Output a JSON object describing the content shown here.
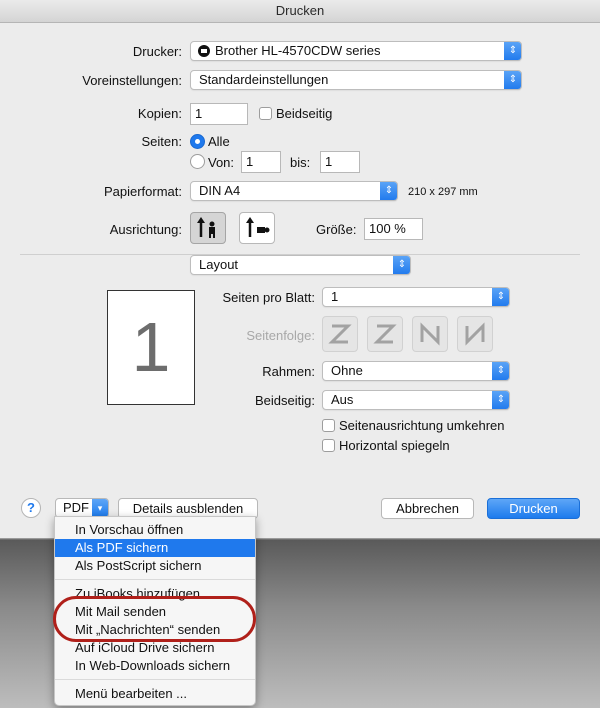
{
  "window": {
    "title": "Drucken"
  },
  "printer": {
    "label": "Drucker:",
    "value": "Brother HL-4570CDW series"
  },
  "presets": {
    "label": "Voreinstellungen:",
    "value": "Standardeinstellungen"
  },
  "copies": {
    "label": "Kopien:",
    "value": "1",
    "duplex_label": "Beidseitig"
  },
  "pages": {
    "label": "Seiten:",
    "all_label": "Alle",
    "from_label": "Von:",
    "from_value": "1",
    "to_label": "bis:",
    "to_value": "1"
  },
  "paper": {
    "label": "Papierformat:",
    "value": "DIN A4",
    "dimensions": "210 x 297 mm"
  },
  "orientation": {
    "label": "Ausrichtung:",
    "scale_label": "Größe:",
    "scale_value": "100 %"
  },
  "section": {
    "value": "Layout"
  },
  "layout": {
    "preview_number": "1",
    "pages_per_sheet_label": "Seiten pro Blatt:",
    "pages_per_sheet_value": "1",
    "order_label": "Seitenfolge:",
    "border_label": "Rahmen:",
    "border_value": "Ohne",
    "duplex_label": "Beidseitig:",
    "duplex_value": "Aus",
    "reverse_orientation_label": "Seitenausrichtung umkehren",
    "flip_horizontal_label": "Horizontal spiegeln"
  },
  "footer": {
    "help": "?",
    "pdf_label": "PDF",
    "details_button": "Details ausblenden",
    "cancel_button": "Abbrechen",
    "print_button": "Drucken"
  },
  "pdf_menu": {
    "items": [
      "In Vorschau öffnen",
      "Als PDF sichern",
      "Als PostScript sichern",
      "Zu iBooks hinzufügen",
      "Mit Mail senden",
      "Mit „Nachrichten“ senden",
      "Auf iCloud Drive sichern",
      "In Web-Downloads sichern",
      "Menü bearbeiten ..."
    ],
    "highlighted": "Als PDF sichern"
  },
  "colors": {
    "accent": "#1f79ed",
    "annotation_ring": "#b0201a"
  }
}
